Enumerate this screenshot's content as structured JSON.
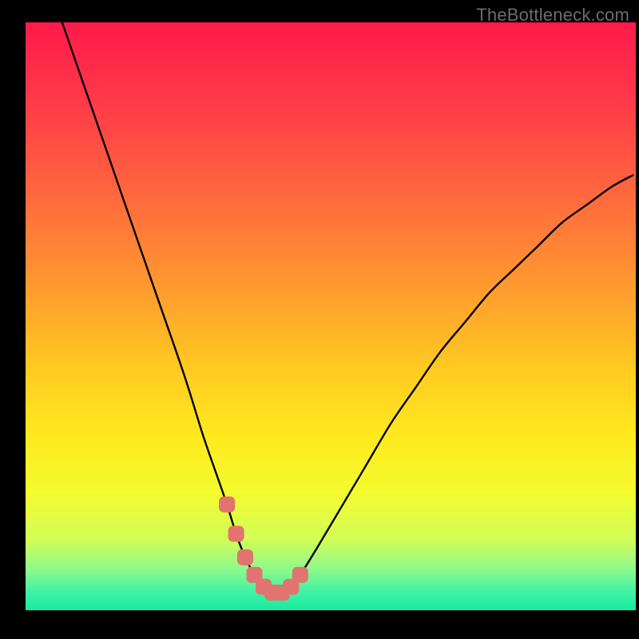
{
  "watermark": "TheBottleneck.com",
  "chart_data": {
    "type": "line",
    "title": "",
    "xlabel": "",
    "ylabel": "",
    "xlim": [
      0,
      100
    ],
    "ylim": [
      0,
      100
    ],
    "x": [
      6,
      10,
      14,
      18,
      22,
      26,
      29,
      31,
      33,
      34.5,
      36,
      37.5,
      39,
      40.5,
      42,
      43.5,
      45,
      48,
      52,
      56,
      60,
      64,
      68,
      72,
      76,
      80,
      84,
      88,
      92,
      96,
      99.5
    ],
    "values": [
      100,
      88,
      76,
      64,
      52,
      40,
      30,
      24,
      18,
      13,
      9,
      6,
      4,
      3,
      3,
      4,
      6,
      11,
      18,
      25,
      32,
      38,
      44,
      49,
      54,
      58,
      62,
      66,
      69,
      72,
      74
    ],
    "series_color": "#000000",
    "markers": {
      "x": [
        33,
        34.5,
        36,
        37.5,
        39,
        40.5,
        42,
        43.5,
        45
      ],
      "values": [
        18,
        13,
        9,
        6,
        4,
        3,
        3,
        4,
        6
      ],
      "color": "#e2746f",
      "shape": "rounded-square"
    },
    "background_gradient": {
      "type": "vertical",
      "stops": [
        {
          "pos": 0.0,
          "color": "#ff1a4b"
        },
        {
          "pos": 0.15,
          "color": "#ff3e47"
        },
        {
          "pos": 0.3,
          "color": "#ff6a3d"
        },
        {
          "pos": 0.45,
          "color": "#ff9a2f"
        },
        {
          "pos": 0.58,
          "color": "#ffc722"
        },
        {
          "pos": 0.7,
          "color": "#ffe91e"
        },
        {
          "pos": 0.8,
          "color": "#f4fb2e"
        },
        {
          "pos": 0.88,
          "color": "#d2fd57"
        },
        {
          "pos": 0.93,
          "color": "#8df98b"
        },
        {
          "pos": 0.97,
          "color": "#3ef2a5"
        },
        {
          "pos": 1.0,
          "color": "#17eaa0"
        }
      ]
    }
  }
}
